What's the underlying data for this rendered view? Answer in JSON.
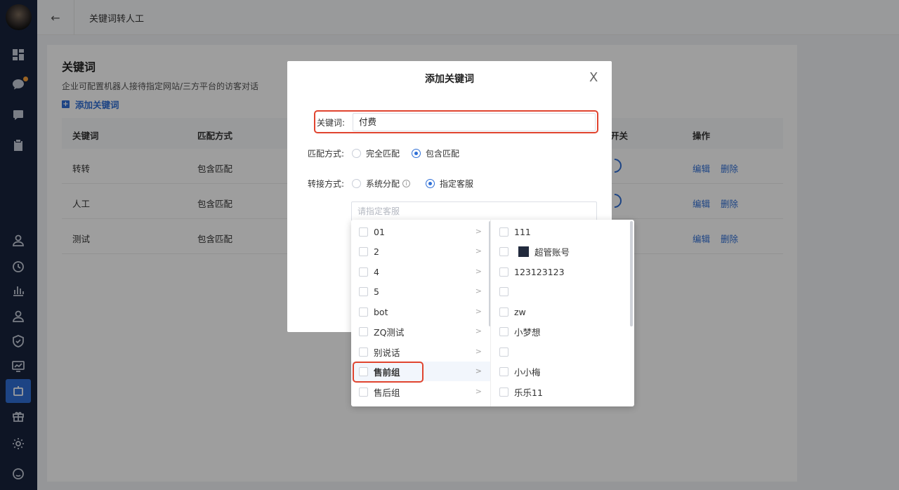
{
  "topbar": {
    "back_icon": "arrow-left-icon",
    "title": "关键词转人工"
  },
  "panel": {
    "title": "关键词",
    "description": "企业可配置机器人接待指定网站/三方平台的访客对话",
    "add_label": "添加关键词"
  },
  "table": {
    "headers": {
      "keyword": "关键词",
      "match": "匹配方式",
      "switch": "开关",
      "actions": "操作"
    },
    "rows": [
      {
        "keyword": "转转",
        "match": "包含匹配",
        "edit": "编辑",
        "delete": "删除"
      },
      {
        "keyword": "人工",
        "match": "包含匹配",
        "edit": "编辑",
        "delete": "删除"
      },
      {
        "keyword": "测试",
        "match": "包含匹配",
        "edit": "编辑",
        "delete": "删除"
      }
    ]
  },
  "modal": {
    "title": "添加关键词",
    "close": "X",
    "keyword_label": "关键词:",
    "keyword_value": "付费",
    "match_label": "匹配方式:",
    "match_options": [
      "完全匹配",
      "包含匹配"
    ],
    "match_selected": "包含匹配",
    "transfer_label": "转接方式:",
    "transfer_options": [
      "系统分配",
      "指定客服"
    ],
    "transfer_selected": "指定客服",
    "agent_placeholder": "请指定客服"
  },
  "cascader": {
    "groups": [
      "01",
      "2",
      "4",
      "5",
      "bot",
      "ZQ测试",
      "别说话",
      "售前组",
      "售后组"
    ],
    "active_group": "售前组",
    "agents": [
      "111",
      "超管账号",
      "123123123",
      "",
      "zw",
      "小梦想",
      "",
      "小小梅",
      "乐乐11"
    ]
  },
  "colors": {
    "accent": "#2f6fd6",
    "highlight": "#e0442f",
    "sidebar": "#17233d"
  }
}
